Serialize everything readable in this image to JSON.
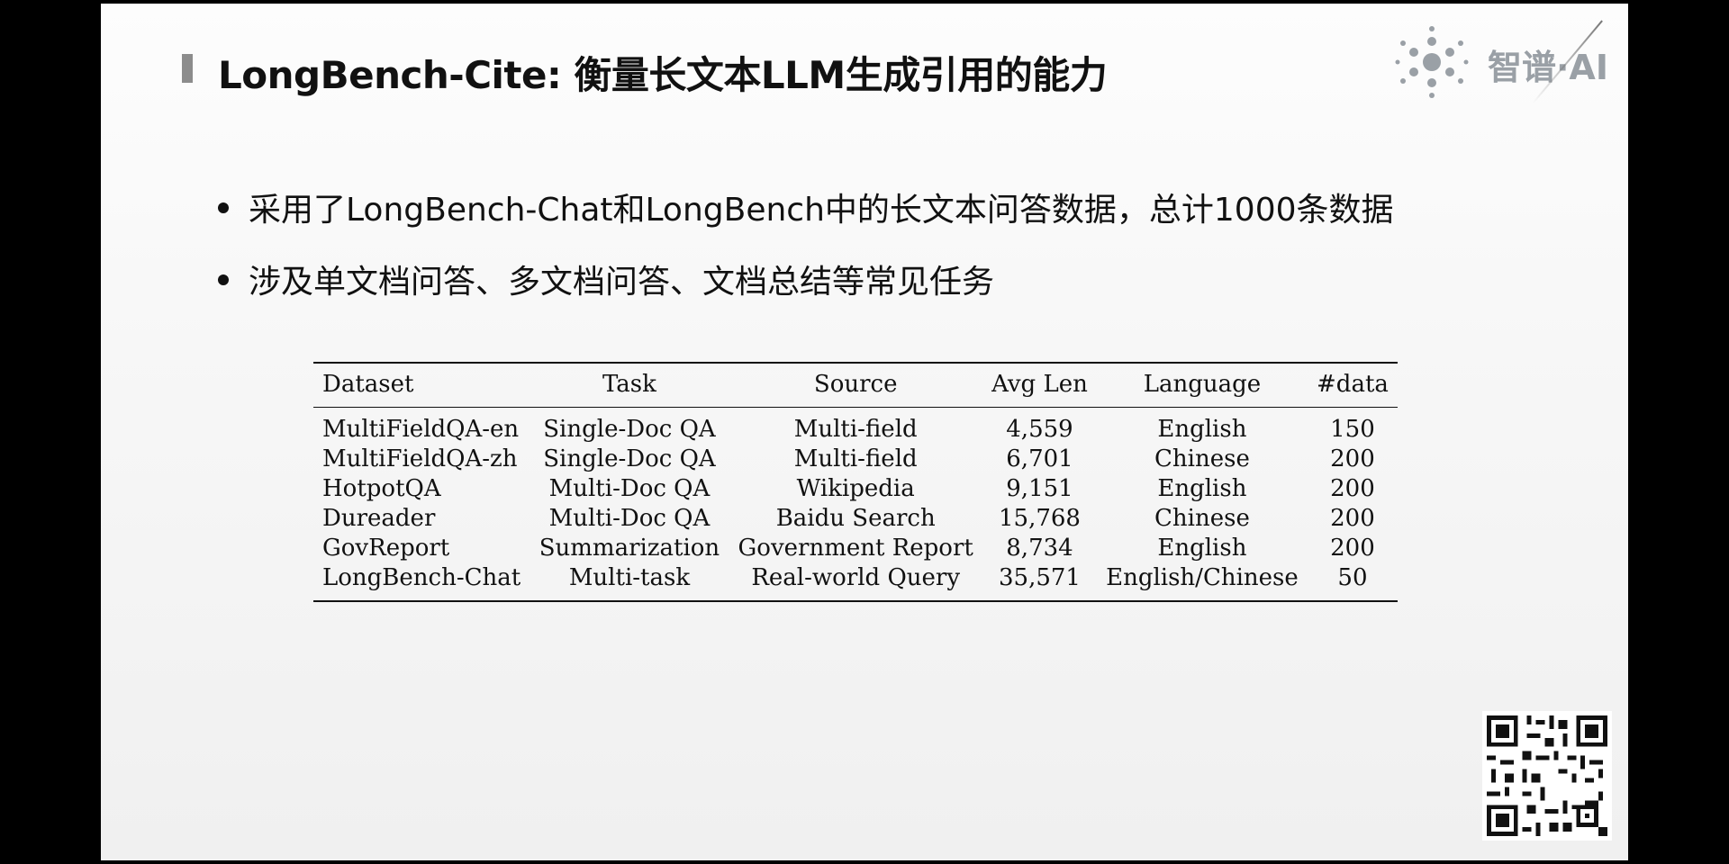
{
  "slide": {
    "title": "LongBench-Cite: 衡量长文本LLM生成引用的能力",
    "logo_text": "智谱·AI",
    "logo_icon": "dot-cluster-logo-icon",
    "bullets": [
      "采用了LongBench-Chat和LongBench中的长文本问答数据，总计1000条数据",
      "涉及单文档问答、多文档问答、文档总结等常见任务"
    ],
    "qr_icon": "qr-code-icon"
  },
  "table": {
    "headers": [
      "Dataset",
      "Task",
      "Source",
      "Avg Len",
      "Language",
      "#data"
    ],
    "rows": [
      [
        "MultiFieldQA-en",
        "Single-Doc QA",
        "Multi-field",
        "4,559",
        "English",
        "150"
      ],
      [
        "MultiFieldQA-zh",
        "Single-Doc QA",
        "Multi-field",
        "6,701",
        "Chinese",
        "200"
      ],
      [
        "HotpotQA",
        "Multi-Doc QA",
        "Wikipedia",
        "9,151",
        "English",
        "200"
      ],
      [
        "Dureader",
        "Multi-Doc QA",
        "Baidu Search",
        "15,768",
        "Chinese",
        "200"
      ],
      [
        "GovReport",
        "Summarization",
        "Government Report",
        "8,734",
        "English",
        "200"
      ],
      [
        "LongBench-Chat",
        "Multi-task",
        "Real-world Query",
        "35,571",
        "English/Chinese",
        "50"
      ]
    ]
  }
}
